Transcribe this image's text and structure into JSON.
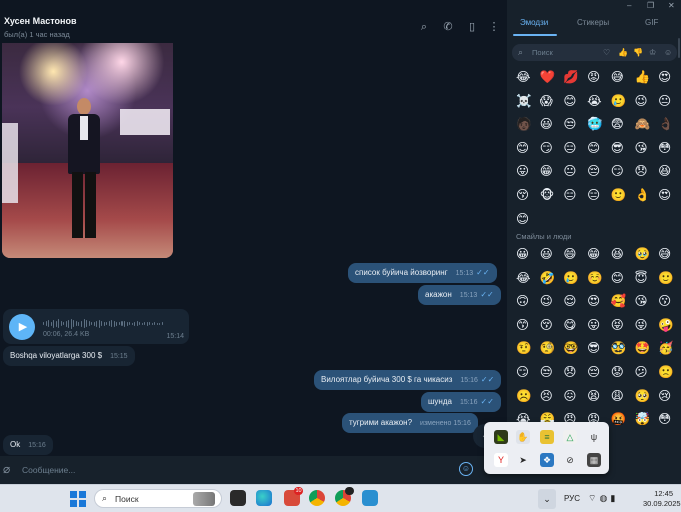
{
  "window": {
    "minimize": "–",
    "maximize": "❐",
    "close": "✕"
  },
  "header": {
    "name": "Хусен Мастонов",
    "status": "был(а) 1 час назад"
  },
  "messages": [
    {
      "text": "список буйича йозворинг",
      "time": "15:13",
      "dir": "out"
    },
    {
      "text": "акажон",
      "time": "15:13",
      "dir": "out"
    },
    {
      "text": "Boshqa viloyatlarga 300 $",
      "time": "15:15",
      "dir": "in"
    },
    {
      "text": "Вилоятлар буйича 300 $ га чикасиз",
      "time": "15:16",
      "dir": "out"
    },
    {
      "text": "шунда",
      "time": "15:16",
      "dir": "out"
    },
    {
      "text": "тугрими акажон?",
      "time": "15:16",
      "edited": "изменено 15:16",
      "dir": "out"
    },
    {
      "text": "Ok",
      "time": "15:16",
      "dir": "in"
    }
  ],
  "voice": {
    "meta": "00:06, 26.4 KB",
    "time": "15:14"
  },
  "composer": {
    "placeholder": "Сообщение..."
  },
  "panel": {
    "tabs": [
      "Эмодзи",
      "Стикеры",
      "GIF"
    ],
    "search_placeholder": "Поиск",
    "categories": [
      "heart-outline-icon",
      "thumbs-up-icon",
      "thumbs-down-icon",
      "trophy-icon",
      "smile-icon"
    ],
    "recent": [
      "😂",
      "❤️",
      "💋",
      "😡",
      "😅",
      "👍",
      "😍",
      "☠️",
      "😱",
      "😊",
      "😭",
      "🥲",
      "😉",
      "😐",
      "🧑🏿",
      "😃",
      "😒",
      "🥶",
      "😨",
      "🙈",
      "👌🏿",
      "😊",
      "😏",
      "😑",
      "😊",
      "😎",
      "😘",
      "😳",
      "😛",
      "😁",
      "😐",
      "😔",
      "😏",
      "😞",
      "😆",
      "😚",
      "🐵",
      "😑",
      "😑",
      "🙂",
      "👌",
      "😍",
      "😊"
    ],
    "section_title": "Смайлы и люди",
    "smileys": [
      "😀",
      "😃",
      "😄",
      "😁",
      "😆",
      "🥹",
      "😅",
      "😂",
      "🤣",
      "🥲",
      "☺️",
      "😊",
      "😇",
      "🙂",
      "🙃",
      "😉",
      "😌",
      "😍",
      "🥰",
      "😘",
      "😗",
      "😙",
      "😚",
      "😋",
      "😛",
      "😝",
      "😜",
      "🤪",
      "🤨",
      "🧐",
      "🤓",
      "😎",
      "🥸",
      "🤩",
      "🥳",
      "😏",
      "😒",
      "😞",
      "😔",
      "😟",
      "😕",
      "🙁",
      "☹️",
      "😣",
      "😖",
      "😫",
      "😩",
      "🥺",
      "😢",
      "😭",
      "😤",
      "😠",
      "😡",
      "🤬",
      "🤯",
      "😳",
      "🥵",
      "🥶",
      "😱",
      "😨"
    ]
  },
  "tray_icons": [
    "nvidia-icon",
    "cursor-app-icon",
    "stack-icon",
    "google-drive-icon",
    "usb-icon",
    "yandex-icon",
    "telegram-icon",
    "network-icon",
    "gamepad-icon",
    "display-icon"
  ],
  "taskbar": {
    "search_label": "Поиск",
    "mail_badge": "10",
    "chrome_badge": "",
    "lang": "РУС",
    "time": "12:45",
    "date": "30.09.2025"
  }
}
